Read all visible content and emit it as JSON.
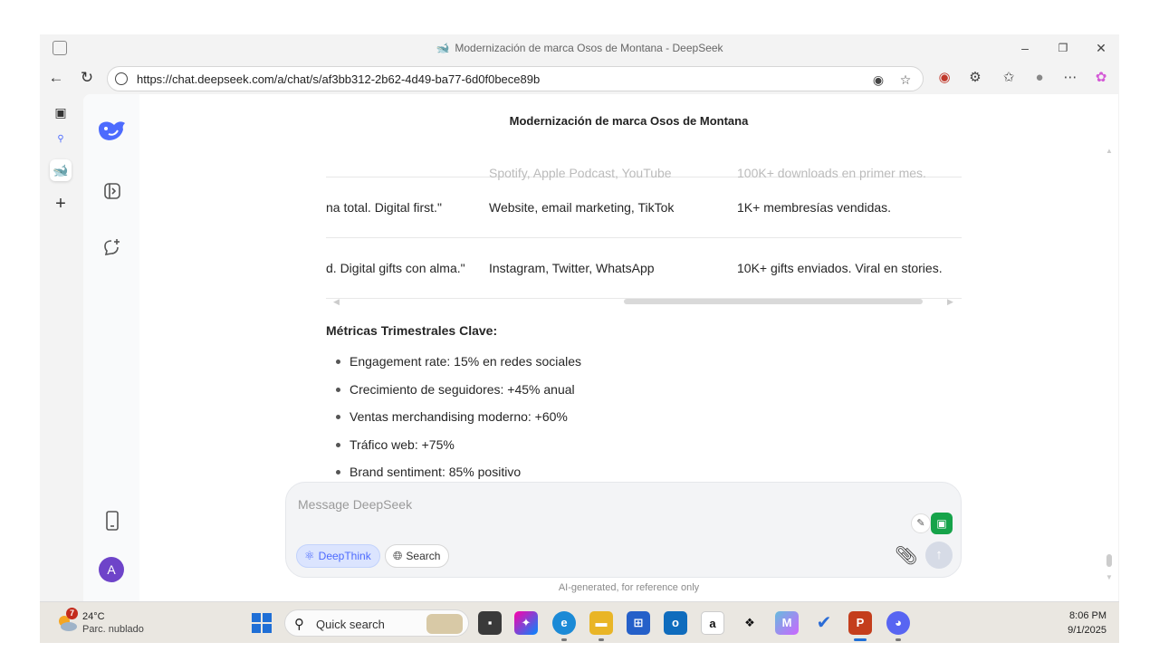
{
  "browser": {
    "window_title": "Modernización de marca Osos de Montana - DeepSeek",
    "url": "https://chat.deepseek.com/a/chat/s/af3bb312-2b62-4d49-ba77-6d0f0bece89b"
  },
  "chat": {
    "title": "Modernización de marca Osos de Montana",
    "table_rows": [
      {
        "c1": "",
        "c2": "Spotify, Apple Podcast, YouTube",
        "c3": "100K+ downloads en primer mes."
      },
      {
        "c1": "na total. Digital first.\"",
        "c2": "Website, email marketing, TikTok",
        "c3": "1K+ membresías vendidas."
      },
      {
        "c1": "d. Digital gifts con alma.\"",
        "c2": "Instagram, Twitter, WhatsApp",
        "c3": "10K+ gifts enviados. Viral en stories."
      }
    ],
    "metrics_heading": "Métricas Trimestrales Clave:",
    "metrics": [
      "Engagement rate: 15% en redes sociales",
      "Crecimiento de seguidores: +45% anual",
      "Ventas merchandising moderno: +60%",
      "Tráfico web: +75%",
      "Brand sentiment: 85% positivo"
    ]
  },
  "composer": {
    "placeholder": "Message DeepSeek",
    "deepthink_label": "DeepThink",
    "search_label": "Search",
    "disclaimer": "AI-generated, for reference only"
  },
  "sidebar": {
    "avatar_letter": "A"
  },
  "taskbar": {
    "weather_badge": "7",
    "temperature": "24°C",
    "condition": "Parc. nublado",
    "search_label": "Quick search",
    "time": "8:06 PM",
    "date": "9/1/2025"
  },
  "colors": {
    "accent": "#4d6bfe",
    "avatar": "#6e44c9",
    "deepthink_bg": "#dbe4fe"
  }
}
